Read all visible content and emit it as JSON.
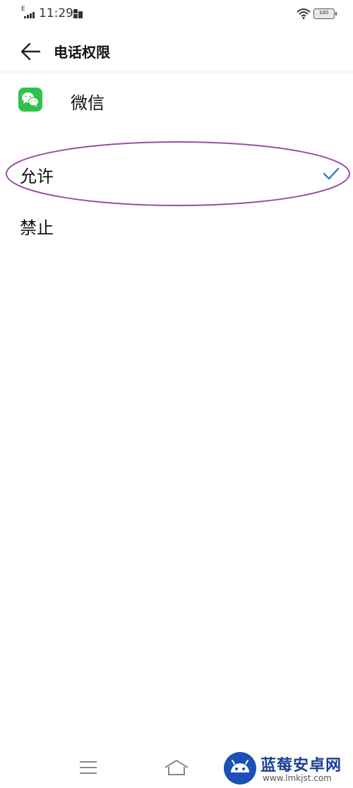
{
  "status_bar": {
    "network_label": "E",
    "time": "11:29",
    "battery_level": "100",
    "icons": [
      "signal-icon",
      "notification-icon",
      "wifi-icon",
      "battery-icon"
    ]
  },
  "header": {
    "back_icon": "back-arrow-icon",
    "title": "电话权限"
  },
  "app": {
    "name": "微信",
    "icon": "wechat-icon",
    "icon_color": "#2ec24d"
  },
  "options": [
    {
      "label": "允许",
      "selected": true
    },
    {
      "label": "禁止",
      "selected": false
    }
  ],
  "accent_color": "#3a7bd5",
  "highlight_color": "#9b4fa6",
  "nav_bar": {
    "icons": [
      "menu-icon",
      "home-icon"
    ]
  },
  "watermark": {
    "title": "蓝莓安卓网",
    "url": "www.lmkjst.com"
  }
}
